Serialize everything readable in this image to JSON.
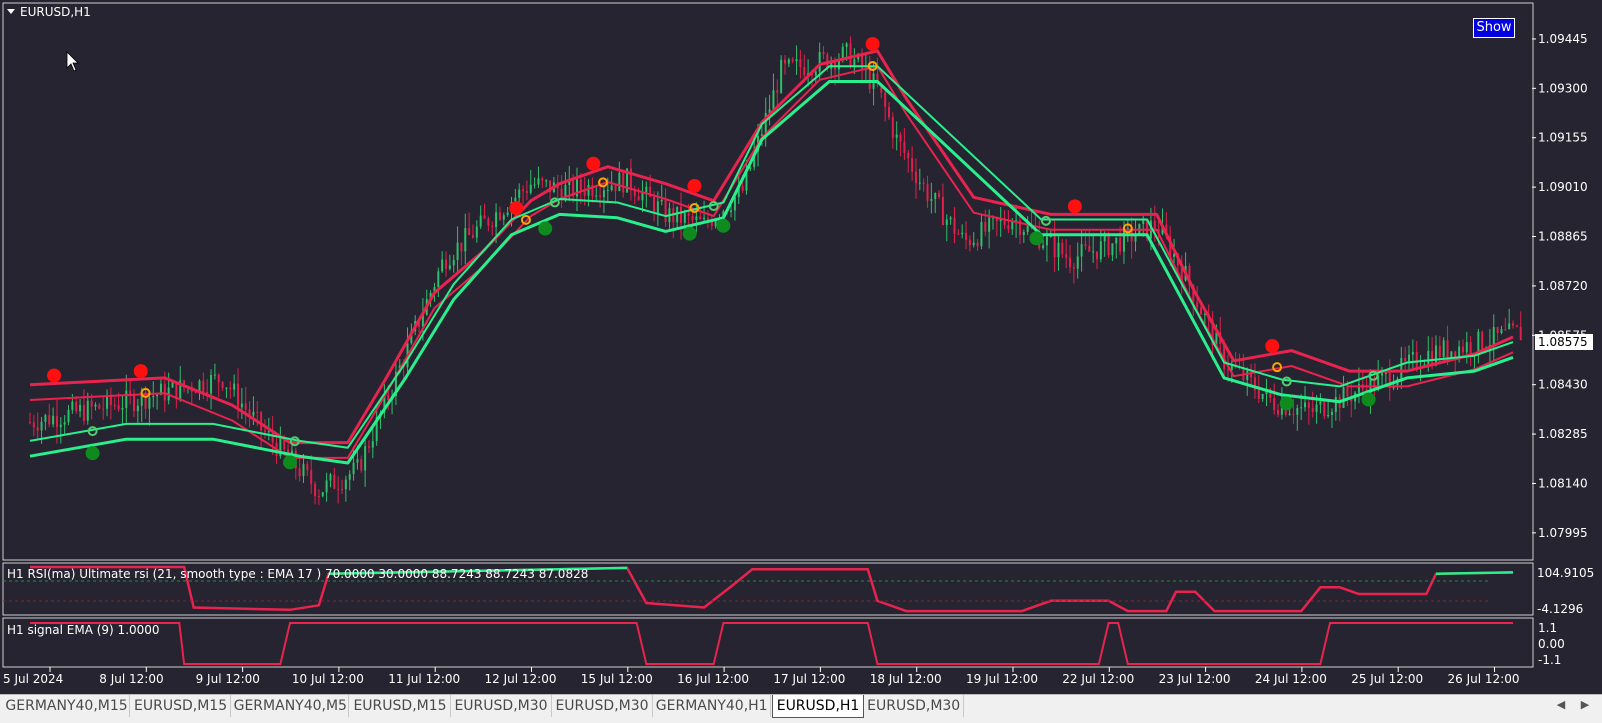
{
  "window": {
    "title": "EURUSD,H1",
    "show_label": "Show"
  },
  "colors": {
    "background": "#262430",
    "bull": "#2fbf6a",
    "bear": "#e0204a",
    "lime": "#29f08c",
    "crimson": "#e8234e",
    "signal_red": "#ff1010",
    "signal_green": "#0f8a1f",
    "arrow": "#ffa500",
    "axis_text": "#ffffff"
  },
  "main_axis": {
    "ticks": [
      "1.09445",
      "1.09300",
      "1.09155",
      "1.09010",
      "1.08865",
      "1.08720",
      "1.08575",
      "1.08430",
      "1.08285",
      "1.08140",
      "1.07995"
    ],
    "current_price": "1.08575"
  },
  "rsi_panel": {
    "label": "H1 RSI(ma) Ultimate rsi (21, smooth type : EMA  17 ) 70.0000 30.0000 88.7243 88.7243 87.0828",
    "ticks": [
      "104.9105",
      "-4.1296"
    ]
  },
  "signal_panel": {
    "label": "H1 signal EMA (9) 1.0000",
    "ticks": [
      "1.1",
      "0.00",
      "-1.1"
    ]
  },
  "time_axis": [
    "5 Jul 2024",
    "8 Jul 12:00",
    "9 Jul 12:00",
    "10 Jul 12:00",
    "11 Jul 12:00",
    "12 Jul 12:00",
    "15 Jul 12:00",
    "16 Jul 12:00",
    "17 Jul 12:00",
    "18 Jul 12:00",
    "19 Jul 12:00",
    "22 Jul 12:00",
    "23 Jul 12:00",
    "24 Jul 12:00",
    "25 Jul 12:00",
    "26 Jul 12:00"
  ],
  "tabs": [
    "GERMANY40,M15",
    "EURUSD,M15",
    "GERMANY40,M5",
    "EURUSD,M15",
    "EURUSD,M30",
    "EURUSD,M30",
    "GERMANY40,H1",
    "EURUSD,H1",
    "EURUSD,M30"
  ],
  "active_tab": 7,
  "chart_data": {
    "type": "line",
    "symbol": "EURUSD",
    "timeframe": "H1",
    "ylim": [
      1.0793,
      1.0953
    ],
    "x_labels": [
      "5 Jul 2024",
      "8 Jul 12:00",
      "9 Jul 12:00",
      "10 Jul 12:00",
      "11 Jul 12:00",
      "12 Jul 12:00",
      "15 Jul 12:00",
      "16 Jul 12:00",
      "17 Jul 12:00",
      "18 Jul 12:00",
      "19 Jul 12:00",
      "22 Jul 12:00",
      "23 Jul 12:00",
      "24 Jul 12:00",
      "25 Jul 12:00",
      "26 Jul 12:00"
    ],
    "price_path": [
      [
        0,
        1.0832
      ],
      [
        1,
        1.0838
      ],
      [
        2,
        1.0845
      ],
      [
        2.4,
        1.083
      ],
      [
        3,
        1.0812
      ],
      [
        3.4,
        1.0818
      ],
      [
        3.8,
        1.0845
      ],
      [
        4.3,
        1.088
      ],
      [
        4.7,
        1.089
      ],
      [
        5.2,
        1.0902
      ],
      [
        5.6,
        1.09
      ],
      [
        6.2,
        1.0903
      ],
      [
        6.6,
        1.0893
      ],
      [
        7.0,
        1.089
      ],
      [
        7.4,
        1.09
      ],
      [
        7.8,
        1.0935
      ],
      [
        8.5,
        1.094
      ],
      [
        8.8,
        1.093
      ],
      [
        9.0,
        1.0915
      ],
      [
        9.3,
        1.09
      ],
      [
        9.7,
        1.0885
      ],
      [
        10.2,
        1.0892
      ],
      [
        10.8,
        1.088
      ],
      [
        11.3,
        1.0885
      ],
      [
        11.7,
        1.089
      ],
      [
        12.0,
        1.0875
      ],
      [
        12.4,
        1.085
      ],
      [
        12.9,
        1.0838
      ],
      [
        13.3,
        1.0835
      ],
      [
        13.7,
        1.084
      ],
      [
        14.1,
        1.0845
      ],
      [
        14.5,
        1.0852
      ],
      [
        15.0,
        1.0855
      ],
      [
        15.4,
        1.0858
      ]
    ],
    "upper_band": [
      [
        0,
        1.0843
      ],
      [
        1.4,
        1.0845
      ],
      [
        2.1,
        1.0837
      ],
      [
        2.7,
        1.0826
      ],
      [
        3.3,
        1.0826
      ],
      [
        3.7,
        1.0845
      ],
      [
        4.2,
        1.087
      ],
      [
        4.7,
        1.0882
      ],
      [
        5.2,
        1.0897
      ],
      [
        5.5,
        1.0902
      ],
      [
        6.0,
        1.0907
      ],
      [
        6.6,
        1.0902
      ],
      [
        7.1,
        1.0897
      ],
      [
        7.6,
        1.092
      ],
      [
        8.2,
        1.0937
      ],
      [
        8.8,
        1.0941
      ],
      [
        9.1,
        1.0927
      ],
      [
        9.8,
        1.0898
      ],
      [
        10.6,
        1.0893
      ],
      [
        11.2,
        1.0893
      ],
      [
        11.7,
        1.0893
      ],
      [
        12.1,
        1.087
      ],
      [
        12.5,
        1.085
      ],
      [
        13.1,
        1.0853
      ],
      [
        13.7,
        1.0847
      ],
      [
        14.3,
        1.0847
      ],
      [
        15.0,
        1.0852
      ],
      [
        15.4,
        1.0857
      ]
    ],
    "lower_band": [
      [
        0,
        1.0822
      ],
      [
        1.0,
        1.0827
      ],
      [
        1.9,
        1.0827
      ],
      [
        2.8,
        1.0822
      ],
      [
        3.3,
        1.082
      ],
      [
        3.9,
        1.0845
      ],
      [
        4.4,
        1.0868
      ],
      [
        5.0,
        1.0887
      ],
      [
        5.5,
        1.0893
      ],
      [
        6.1,
        1.0892
      ],
      [
        6.6,
        1.0888
      ],
      [
        7.2,
        1.0892
      ],
      [
        7.6,
        1.0915
      ],
      [
        8.3,
        1.0932
      ],
      [
        8.8,
        1.0932
      ],
      [
        10.5,
        1.0887
      ],
      [
        11.6,
        1.0887
      ],
      [
        12.4,
        1.0845
      ],
      [
        13.0,
        1.084
      ],
      [
        13.6,
        1.0838
      ],
      [
        14.3,
        1.0845
      ],
      [
        15.0,
        1.0847
      ],
      [
        15.4,
        1.0851
      ]
    ],
    "series": [
      {
        "name": "H1 RSI(ma) Ultimate rsi (21, smooth type : EMA  17 )",
        "levels": [
          70.0,
          30.0
        ],
        "values": [
          88.7243,
          88.7243,
          87.0828
        ],
        "ylim": [
          -4.1296,
          104.9105
        ]
      },
      {
        "name": "H1 signal EMA (9)",
        "value": 1.0,
        "ylim": [
          -1.1,
          1.1
        ]
      }
    ]
  }
}
